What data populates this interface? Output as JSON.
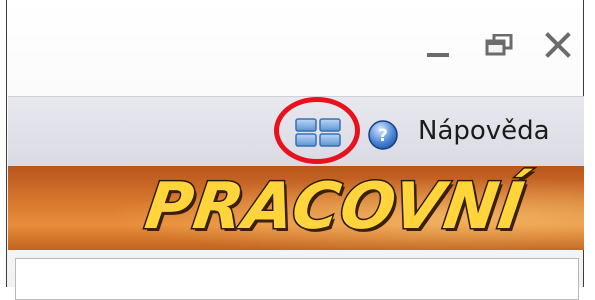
{
  "window": {
    "controls": {
      "minimize_icon": "minimize-icon",
      "maximize_icon": "restore-icon",
      "close_icon": "close-icon"
    }
  },
  "toolbar": {
    "layout_icon": "layout-grid-icon",
    "help_icon": "help-icon",
    "help_label": "Nápověda",
    "highlight_color": "#e8121f"
  },
  "banner": {
    "title": "PRACOVNÍ"
  }
}
